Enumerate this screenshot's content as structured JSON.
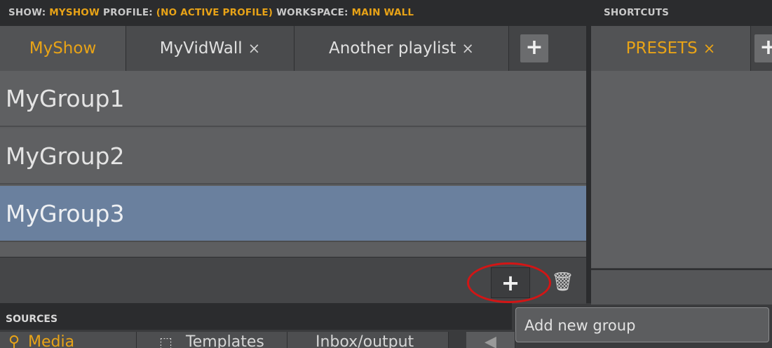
{
  "header": {
    "show_label": "SHOW:",
    "show_value": "MYSHOW",
    "profile_label": "PROFILE:",
    "profile_value": "(NO ACTIVE PROFILE)",
    "workspace_label": "WORKSPACE:",
    "workspace_value": "MAIN WALL",
    "shortcuts_label": "SHORTCUTS"
  },
  "tabs": [
    {
      "label": "MyShow",
      "closable": false,
      "active": true
    },
    {
      "label": "MyVidWall",
      "closable": true,
      "active": false
    },
    {
      "label": "Another playlist",
      "closable": true,
      "active": false
    }
  ],
  "tab_close_glyph": "×",
  "add_tab_glyph": "+",
  "shortcut_tabs": [
    {
      "label": "PRESETS",
      "closable": true,
      "active": true
    }
  ],
  "groups": [
    {
      "label": "MyGroup1",
      "selected": false
    },
    {
      "label": "MyGroup2",
      "selected": false
    },
    {
      "label": "MyGroup3",
      "selected": true
    }
  ],
  "toolbar": {
    "add_glyph": "+",
    "trash_glyph": "🗑"
  },
  "tooltip": "Add new group",
  "sources": {
    "title": "SOURCES",
    "tabs": [
      {
        "label": "Media",
        "icon": "search-icon"
      },
      {
        "label": "Templates",
        "icon": "template-icon"
      },
      {
        "label": "Inbox/output"
      }
    ]
  },
  "colors": {
    "accent": "#e8a317",
    "selection": "#6a809e",
    "highlight_circle": "#d31515"
  }
}
